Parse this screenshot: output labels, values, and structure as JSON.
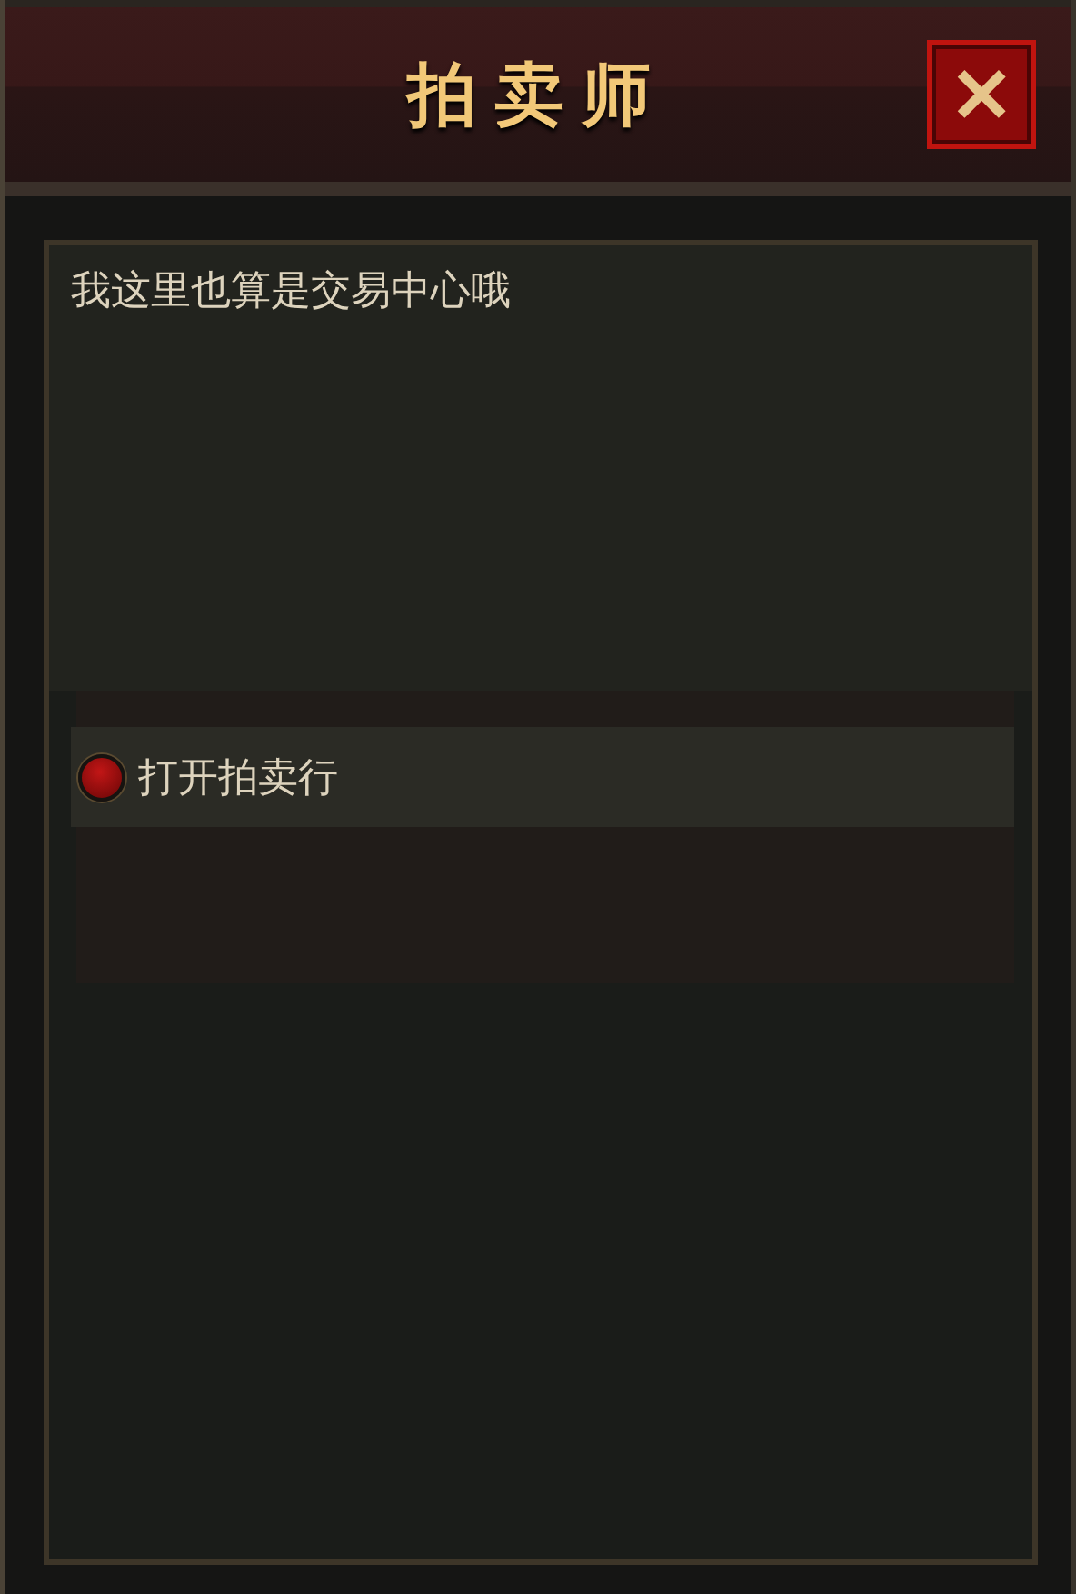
{
  "window": {
    "title": "拍卖师",
    "close": "✕"
  },
  "dialog": {
    "text": "我这里也算是交易中心哦"
  },
  "options": [
    {
      "label": "打开拍卖行"
    }
  ]
}
